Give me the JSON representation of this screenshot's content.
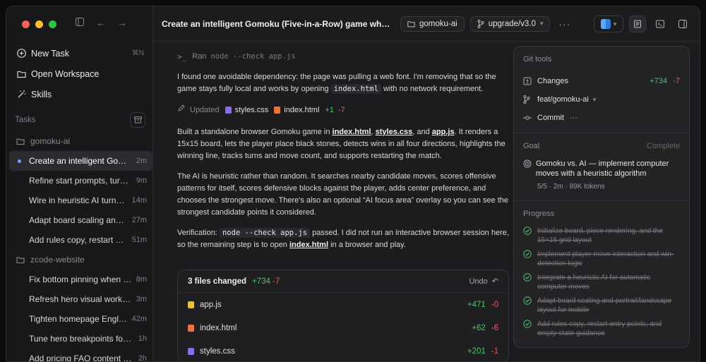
{
  "sidebar": {
    "nav": [
      {
        "label": "New Task",
        "icon": "plus-circle-icon",
        "shortcut": "⌘N"
      },
      {
        "label": "Open Workspace",
        "icon": "folder-icon"
      },
      {
        "label": "Skills",
        "icon": "wand-icon"
      }
    ],
    "tasks_label": "Tasks",
    "groups": [
      {
        "name": "gomoku-ai",
        "tasks": [
          {
            "title": "Create an intelligent Gomoku (Five-in-a-Row) game",
            "age": "2m",
            "active": true
          },
          {
            "title": "Refine start prompts, turn indicators",
            "age": "9m"
          },
          {
            "title": "Wire in heuristic AI turns and scoring",
            "age": "14m"
          },
          {
            "title": "Adapt board scaling and layout",
            "age": "27m"
          },
          {
            "title": "Add rules copy, restart entry points",
            "age": "51m"
          }
        ]
      },
      {
        "name": "zcode-website",
        "tasks": [
          {
            "title": "Fix bottom pinning when scrolling",
            "age": "8m"
          },
          {
            "title": "Refresh hero visual workflow",
            "age": "3m"
          },
          {
            "title": "Tighten homepage English copy",
            "age": "42m"
          },
          {
            "title": "Tune hero breakpoints for mobile",
            "age": "1h"
          },
          {
            "title": "Add pricing FAQ content and layout",
            "age": "2h"
          }
        ]
      }
    ]
  },
  "header": {
    "title": "Create an intelligent Gomoku (Five-in-a-Row) game where the ...",
    "workspace": "gomoku-ai",
    "branch": "upgrade/v3.0"
  },
  "conversation": {
    "ran_label": "Ran",
    "ran_cmd": "node --check app.js",
    "p1a": "I found one avoidable dependency: the page was pulling a web font. I'm removing that so the game stays fully local and works by opening",
    "p1code": "index.html",
    "p1b": "with no network requirement.",
    "updated_label": "Updated",
    "updated_files": [
      {
        "name": "styles.css",
        "kind": "css"
      },
      {
        "name": "index.html",
        "kind": "html"
      }
    ],
    "updated_plus": "+1",
    "updated_minus": "-7",
    "p2a": "Built a standalone browser Gomoku game in",
    "p2l1": "index.html",
    "p2s1": ",",
    "p2l2": "styles.css",
    "p2s2": ", and",
    "p2l3": "app.js",
    "p2b": ". It renders a 15x15 board, lets the player place black stones, detects wins in all four directions, highlights the winning line, tracks turns and move count, and supports restarting the match.",
    "p3": "The AI is heuristic rather than random. It searches nearby candidate moves, scores offensive patterns for itself, scores defensive blocks against the player, adds center preference, and chooses the strongest move. There's also an optional “AI focus area” overlay so you can see the strongest candidate points it considered.",
    "p4a": "Verification:",
    "p4code": "node --check app.js",
    "p4b": "passed. I did not run an interactive browser session here, so the remaining step is to open",
    "p4link": "index.html",
    "p4c": "in a browser and play."
  },
  "files_changed": {
    "title": "3 files changed",
    "plus": "+734",
    "minus": "-7",
    "undo": "Undo",
    "files": [
      {
        "name": "app.js",
        "kind": "js",
        "plus": "+471",
        "minus": "-0"
      },
      {
        "name": "index.html",
        "kind": "html",
        "plus": "+62",
        "minus": "-6"
      },
      {
        "name": "styles.css",
        "kind": "css",
        "plus": "+201",
        "minus": "-1"
      }
    ]
  },
  "panel": {
    "git_title": "Git tools",
    "changes_label": "Changes",
    "changes_plus": "+734",
    "changes_minus": "-7",
    "branch": "feat/gomoku-ai",
    "commit_label": "Commit",
    "goal_title": "Goal",
    "goal_status": "Complete",
    "goal_text": "Gomoku vs. AI — implement computer moves with a heuristic algorithm",
    "goal_meta": "5/5 · 2m · 89K tokens",
    "progress_title": "Progress",
    "progress": [
      "Initialize board, piece rendering, and the 15×15 grid layout",
      "Implement player move interaction and win-detection logic",
      "Integrate a heuristic AI for automatic computer moves",
      "Adapt board scaling and portrait/landscape layout for mobile",
      "Add rules copy, restart entry points, and empty-state guidance"
    ]
  },
  "colors": {
    "accent_blue": "#6ea8fe",
    "plus": "#4cc36b",
    "minus": "#ee5a5a"
  }
}
